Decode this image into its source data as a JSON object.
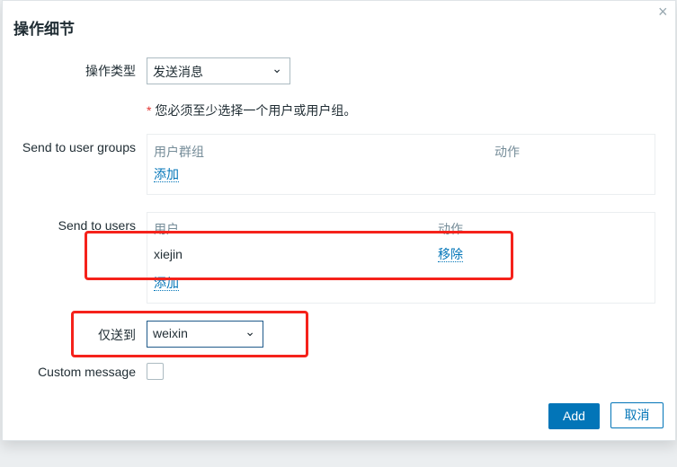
{
  "dialog": {
    "title": "操作细节",
    "close_icon": "×"
  },
  "operation_type": {
    "label": "操作类型",
    "value": "发送消息"
  },
  "error": {
    "asterisk": "*",
    "text": "您必须至少选择一个用户或用户组。"
  },
  "user_groups": {
    "label": "Send to user groups",
    "col_group": "用户群组",
    "col_action": "动作",
    "add": "添加"
  },
  "users": {
    "label": "Send to users",
    "col_user": "用户",
    "col_action": "动作",
    "rows": [
      {
        "user": "xiejin",
        "action": "移除"
      }
    ],
    "add": "添加"
  },
  "send_only_to": {
    "label": "仅送到",
    "value": "weixin"
  },
  "custom_message": {
    "label": "Custom message",
    "checked": false
  },
  "buttons": {
    "add": "Add",
    "cancel": "取消"
  },
  "colors": {
    "accent": "#0275b8",
    "highlight": "#f5221b"
  }
}
